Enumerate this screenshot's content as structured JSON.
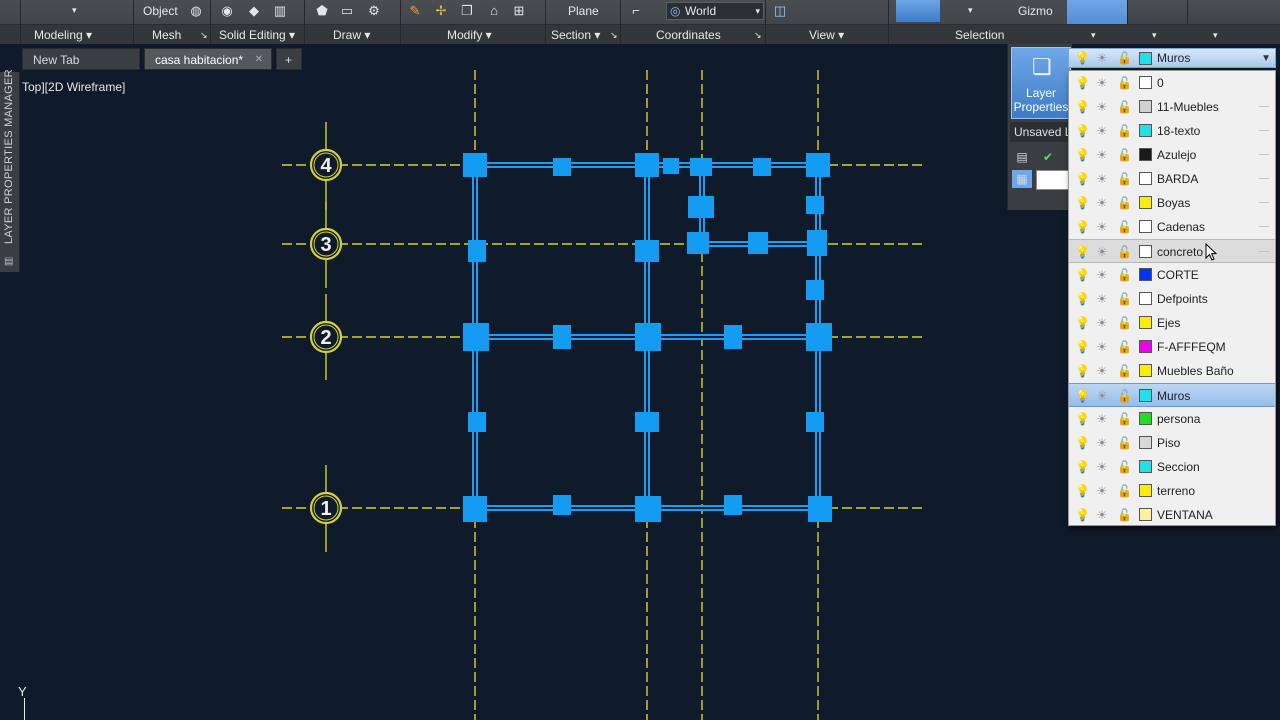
{
  "ribbon": {
    "top_labels": {
      "object": "Object",
      "plane": "Plane",
      "world": "World",
      "gizmo": "Gizmo"
    },
    "panels": [
      "Modeling",
      "Mesh",
      "Solid Editing",
      "Draw",
      "Modify",
      "Section",
      "Coordinates",
      "View",
      "Selection"
    ]
  },
  "tabs": {
    "new_tab": "New Tab",
    "active_tab": "casa habitacion*",
    "add": "+"
  },
  "palette_strip": {
    "title": "LAYER PROPERTIES MANAGER"
  },
  "viewport": {
    "label": "Top][2D Wireframe]"
  },
  "grid": {
    "bubbles": [
      "4",
      "3",
      "2",
      "1"
    ]
  },
  "layer_panel": {
    "button_label_line1": "Layer",
    "button_label_line2": "Properties",
    "state": "Unsaved L"
  },
  "layer_dropdown": {
    "current": {
      "name": "Muros",
      "color": "#22e0e8"
    },
    "layers": [
      {
        "name": "0",
        "color": "#ffffff"
      },
      {
        "name": "11-Muebles",
        "color": "#d0d0d0"
      },
      {
        "name": "18-texto",
        "color": "#22e0e8"
      },
      {
        "name": "Azulejo",
        "color": "#1a1a1a"
      },
      {
        "name": "BARDA",
        "color": "#ffffff"
      },
      {
        "name": "Boyas",
        "color": "#ffee00"
      },
      {
        "name": "Cadenas",
        "color": "#ffffff"
      },
      {
        "name": "concreto",
        "color": "#ffffff"
      },
      {
        "name": "CORTE",
        "color": "#0033ff"
      },
      {
        "name": "Defpoints",
        "color": "#ffffff"
      },
      {
        "name": "Ejes",
        "color": "#ffee00"
      },
      {
        "name": "F-AFFFEQM",
        "color": "#ee00ee"
      },
      {
        "name": "Muebles Baño",
        "color": "#ffee00"
      },
      {
        "name": "Muros",
        "color": "#22e0e8"
      },
      {
        "name": "persona",
        "color": "#22dd22"
      },
      {
        "name": "Piso",
        "color": "#d8d8d8"
      },
      {
        "name": "Seccion",
        "color": "#22e0e8"
      },
      {
        "name": "terreno",
        "color": "#ffee00"
      },
      {
        "name": "VENTANA",
        "color": "#fff0a0"
      }
    ],
    "hovered": "concreto",
    "selected": "Muros"
  },
  "ucs": {
    "axis": "Y"
  },
  "colors": {
    "canvas_bg": "#0f1a2a",
    "grid_line": "#d4d23a",
    "wall": "#1e9ef2",
    "grip": "#139cf2"
  }
}
